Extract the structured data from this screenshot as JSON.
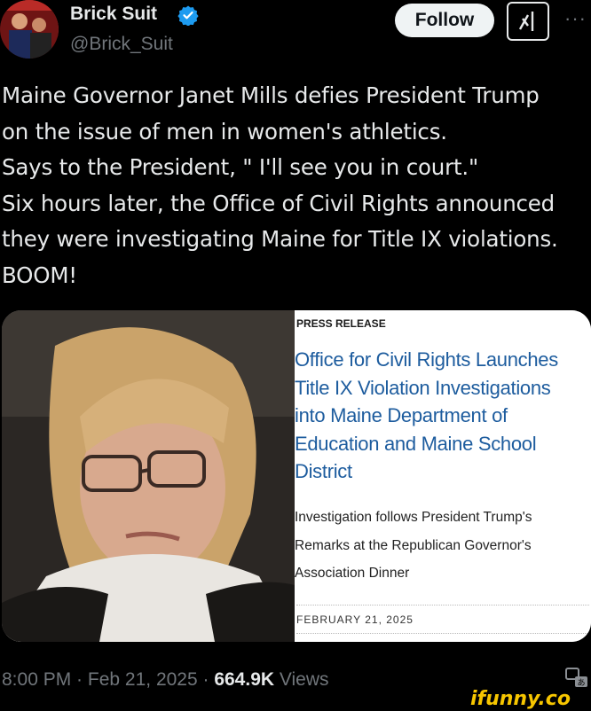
{
  "header": {
    "display_name": "Brick Suit",
    "handle": "@Brick_Suit",
    "follow_label": "Follow",
    "more_label": "···"
  },
  "tweet": {
    "text": "Maine Governor Janet Mills defies President Trump\non the issue of men in women's athletics.\nSays to the President, \" I'll see you in court.\"\nSix hours later, the Office of Civil Rights announced\nthey were investigating Maine for Title IX violations.\nBOOM!"
  },
  "card": {
    "label": "PRESS RELEASE",
    "title": "Office for Civil Rights Launches\nTitle IX Violation Investigations\ninto Maine Department of\nEducation and Maine School\nDistrict",
    "subtitle": "Investigation follows President Trump's\nRemarks at the Republican Governor's\nAssociation Dinner",
    "date": "FEBRUARY 21, 2025"
  },
  "meta": {
    "time": "8:00 PM",
    "separator": " · ",
    "date": "Feb 21, 2025",
    "views_count": "664.9K",
    "views_label": "Views"
  },
  "watermark": "ifunny.co",
  "colors": {
    "background": "#000000",
    "accent_link": "#1d5c9e",
    "verified": "#1d9bf0",
    "muted": "#71767b"
  }
}
